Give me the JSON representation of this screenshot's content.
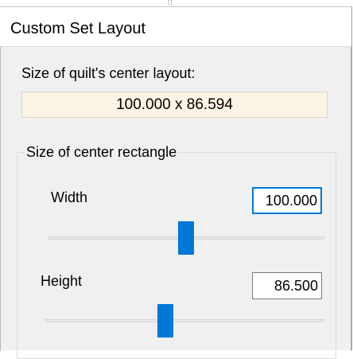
{
  "dialog": {
    "title": "Custom Set Layout"
  },
  "layout_size": {
    "label": "Size of quilt's center layout:",
    "value": "100.000 x 86.594"
  },
  "center_rectangle": {
    "group_label": "Size of center rectangle",
    "width": {
      "label": "Width",
      "value": "100.000",
      "slider_position": 0.5
    },
    "height": {
      "label": "Height",
      "value": "86.500",
      "slider_position": 0.43
    }
  },
  "colors": {
    "accent": "#0078d7",
    "display_background": "#fbf3e4"
  }
}
